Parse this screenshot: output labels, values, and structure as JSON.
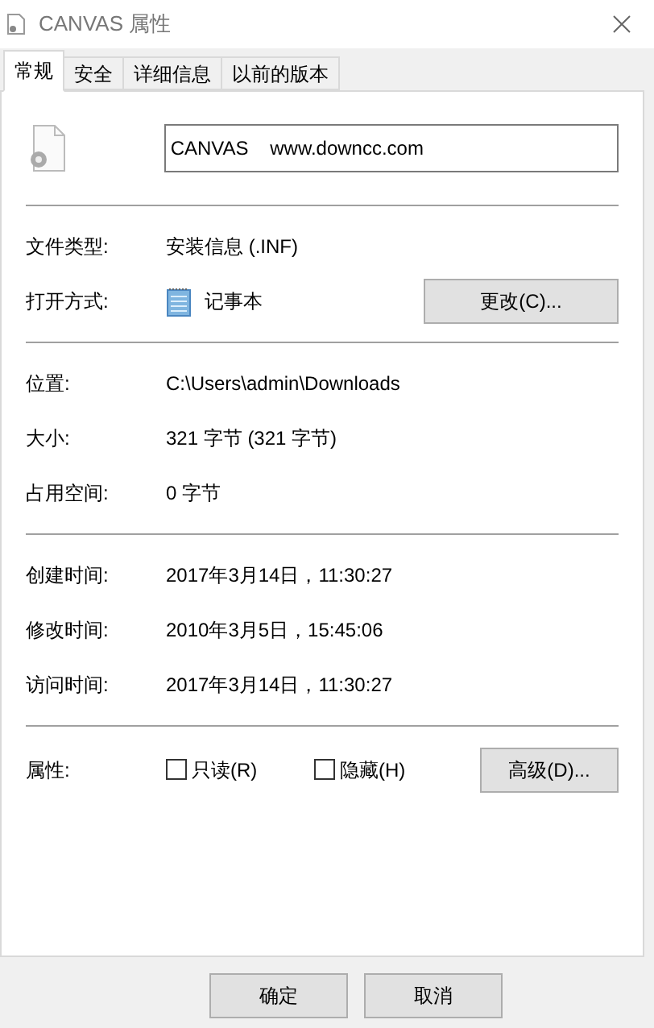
{
  "window": {
    "title": "CANVAS 属性"
  },
  "tabs": [
    {
      "label": "常规",
      "selected": true
    },
    {
      "label": "安全",
      "selected": false
    },
    {
      "label": "详细信息",
      "selected": false
    },
    {
      "label": "以前的版本",
      "selected": false
    }
  ],
  "file_name": "CANVAS    www.downcc.com",
  "sections": [
    [
      {
        "label": "文件类型:",
        "value": "安装信息 (.INF)"
      },
      {
        "label": "打开方式:",
        "value": "记事本",
        "app_icon": true,
        "button": "更改(C)..."
      }
    ],
    [
      {
        "label": "位置:",
        "value": "C:\\Users\\admin\\Downloads"
      },
      {
        "label": "大小:",
        "value": "321 字节 (321 字节)"
      },
      {
        "label": "占用空间:",
        "value": "0 字节"
      }
    ],
    [
      {
        "label": "创建时间:",
        "value": "2017年3月14日，11:30:27"
      },
      {
        "label": "修改时间:",
        "value": "2010年3月5日，15:45:06"
      },
      {
        "label": "访问时间:",
        "value": "2017年3月14日，11:30:27"
      }
    ]
  ],
  "attributes": {
    "label": "属性:",
    "checkboxes": [
      {
        "label": "只读(R)",
        "checked": false
      },
      {
        "label": "隐藏(H)",
        "checked": false
      }
    ],
    "button": "高级(D)..."
  },
  "buttons": [
    "确定",
    "取消"
  ]
}
